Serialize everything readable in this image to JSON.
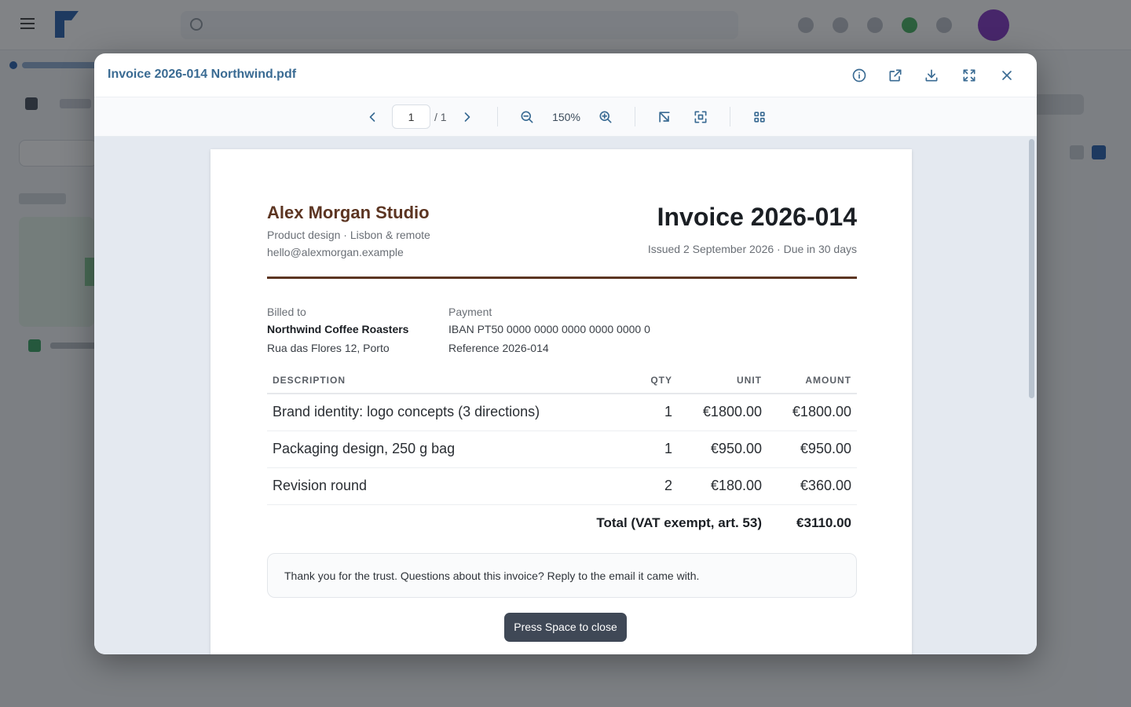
{
  "viewer": {
    "filename": "Invoice 2026-014 Northwind.pdf",
    "page_current": "1",
    "page_total": "/ 1",
    "zoom": "150%",
    "close_hint": "Press Space to close"
  },
  "invoice": {
    "studio_name": "Alex Morgan Studio",
    "studio_tagline": "Product design · Lisbon & remote",
    "studio_email": "hello@alexmorgan.example",
    "title": "Invoice 2026-014",
    "issued": "Issued 2 September 2026 · Due in 30 days",
    "billed_label": "Billed to",
    "billed_name": "Northwind Coffee Roasters",
    "billed_address": "Rua das Flores 12, Porto",
    "payment_label": "Payment",
    "payment_iban": "IBAN PT50 0000 0000 0000 0000 0000 0",
    "payment_reference": "Reference 2026-014",
    "columns": {
      "description": "DESCRIPTION",
      "qty": "QTY",
      "unit": "UNIT",
      "amount": "AMOUNT"
    },
    "items": [
      {
        "description": "Brand identity: logo concepts (3 directions)",
        "qty": "1",
        "unit": "€1800.00",
        "amount": "€1800.00"
      },
      {
        "description": "Packaging design, 250 g bag",
        "qty": "1",
        "unit": "€950.00",
        "amount": "€950.00"
      },
      {
        "description": "Revision round",
        "qty": "2",
        "unit": "€180.00",
        "amount": "€360.00"
      }
    ],
    "total_label": "Total (VAT exempt, art. 53)",
    "total_amount": "€3110.00",
    "note": "Thank you for the trust. Questions about this invoice? Reply to the email it came with."
  },
  "icons": {
    "info": "info-icon",
    "open_external": "external-link-icon",
    "download": "download-icon",
    "fullscreen": "fullscreen-icon",
    "close": "close-icon",
    "prev": "chevron-left-icon",
    "next": "chevron-right-icon",
    "zoom_out": "zoom-out-icon",
    "zoom_in": "zoom-in-icon",
    "fit_width": "fit-width-icon",
    "fit_page": "fit-page-icon",
    "thumbnails": "grid-icon"
  },
  "colors": {
    "accent": "#3a6b93",
    "brand": "#5c3522",
    "hint_bg": "#3f4856"
  }
}
